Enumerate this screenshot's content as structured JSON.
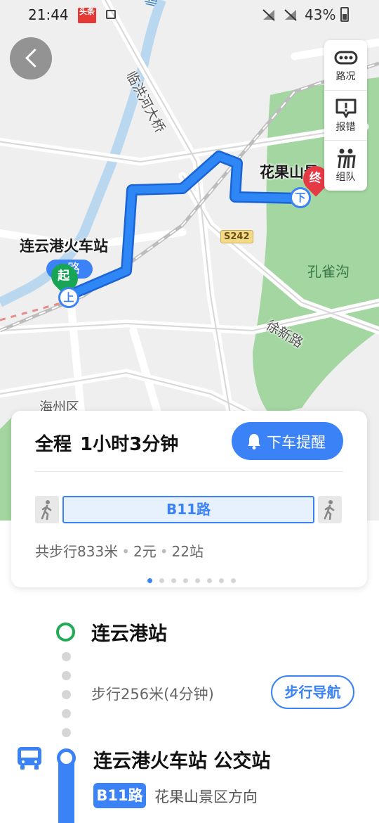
{
  "status_bar": {
    "time": "21:44",
    "app_badge": "头条",
    "battery": "43%"
  },
  "map": {
    "labels": {
      "river_top": "临洪河",
      "bridge": "临洪河大桥",
      "start_station": "连云港火车站",
      "destination": "花果山景",
      "peacock": "孔雀沟",
      "xuxin_road": "徐新路",
      "district": "海州区",
      "highway": "S242",
      "route_badge": "路"
    },
    "pins": {
      "start": "起",
      "end": "终",
      "board": "上",
      "alight": "下"
    },
    "tools": [
      {
        "label": "路况",
        "icon": "traffic-icon"
      },
      {
        "label": "报错",
        "icon": "report-error-icon"
      },
      {
        "label": "组队",
        "icon": "team-icon"
      }
    ]
  },
  "summary": {
    "total_label": "全程",
    "duration": "1小时3分钟",
    "alert_button": "下车提醒",
    "bus_route": "B11路",
    "meta": {
      "walk": "共步行833米",
      "fare": "2元",
      "stops": "22站"
    },
    "pages": 8,
    "active_page": 0
  },
  "detail": {
    "start_stop": "连云港站",
    "walk_text": "步行256米(4分钟)",
    "walk_nav_button": "步行导航",
    "bus_stop": "连云港火车站 公交站",
    "route_tag": "B11路",
    "direction": "花果山景区方向"
  },
  "colors": {
    "accent": "#3b82f6",
    "start": "#19a556",
    "end": "#e63946",
    "park": "#9ed49a"
  }
}
